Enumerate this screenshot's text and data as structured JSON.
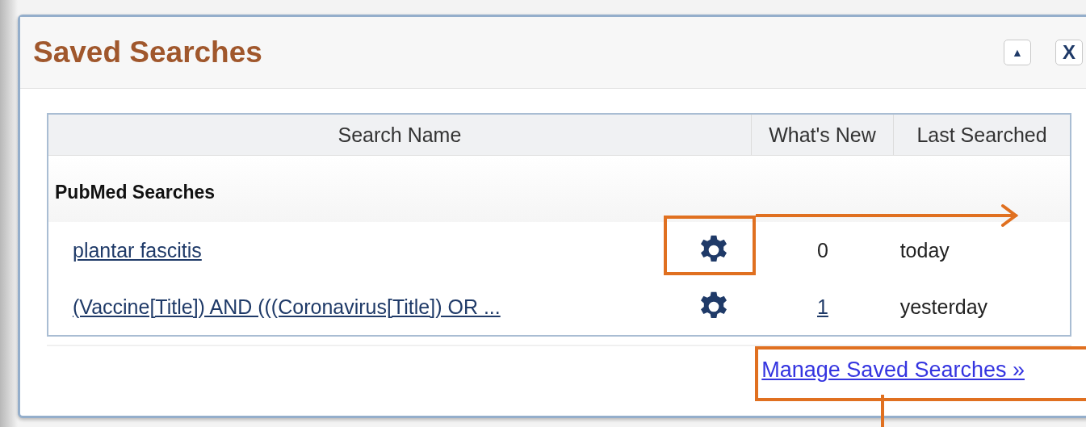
{
  "panel": {
    "title": "Saved Searches",
    "collapse_button": "▲",
    "close_button": "X"
  },
  "table": {
    "columns": [
      "Search Name",
      "What's New",
      "Last Searched"
    ],
    "groups": [
      {
        "label": "PubMed Searches",
        "rows": [
          {
            "name": "plantar fascitis",
            "whats_new": "0",
            "whats_new_linked": false,
            "last_searched": "today",
            "highlighted": true
          },
          {
            "name": "(Vaccine[Title]) AND (((Coronavirus[Title]) OR ...",
            "whats_new": "1",
            "whats_new_linked": true,
            "last_searched": "yesterday",
            "highlighted": false
          }
        ]
      }
    ]
  },
  "manage_link": {
    "label": "Manage Saved Searches »",
    "highlighted": true
  }
}
